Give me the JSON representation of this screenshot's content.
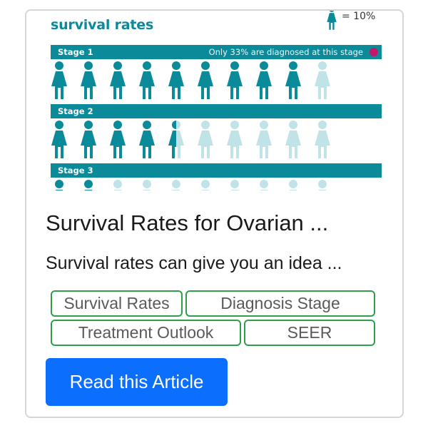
{
  "infographic": {
    "title": "survival rates",
    "legend_text": "= 10%",
    "colors": {
      "brand": "#0b8a99",
      "faded": "#bfe3e6",
      "dot": "#c2186b"
    },
    "stages": [
      {
        "label": "Stage 1",
        "note": "Only 33% are diagnosed at this stage",
        "survival_figures": 9
      },
      {
        "label": "Stage 2",
        "note": "",
        "survival_figures": 4.5
      },
      {
        "label": "Stage 3",
        "note": "",
        "survival_figures": 2
      }
    ],
    "figure_icon": "woman-icon"
  },
  "card": {
    "title": "Survival Rates for Ovarian ...",
    "description": "Survival rates can give you an idea ...",
    "tags": [
      "Survival Rates",
      "Diagnosis Stage",
      "Treatment Outlook",
      "SEER"
    ],
    "button_label": "Read this Article"
  },
  "colors": {
    "tag_border": "#2e9e4a",
    "button": "#0b6efd"
  }
}
